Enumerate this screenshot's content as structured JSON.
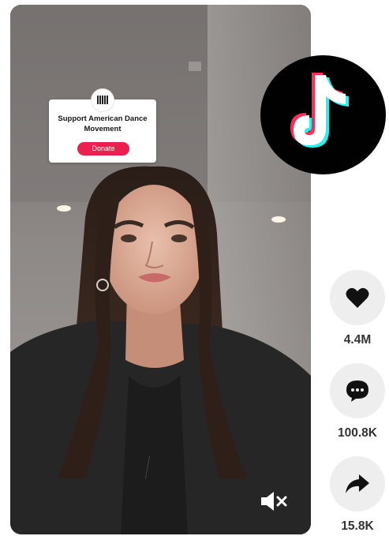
{
  "donation_sticker": {
    "title": "Support American Dance Movement",
    "button_label": "Donate"
  },
  "actions": {
    "like": {
      "icon": "heart-icon",
      "count": "4.4M"
    },
    "comment": {
      "icon": "comment-icon",
      "count": "100.8K"
    },
    "share": {
      "icon": "share-arrow-icon",
      "count": "15.8K"
    }
  },
  "player": {
    "mute_icon": "speaker-muted-icon"
  },
  "brand": {
    "logo_icon": "tiktok-logo-icon",
    "colors": {
      "accent_pink": "#ea2150",
      "logo_red": "#fe2c55",
      "logo_cyan": "#25f4ee"
    }
  }
}
